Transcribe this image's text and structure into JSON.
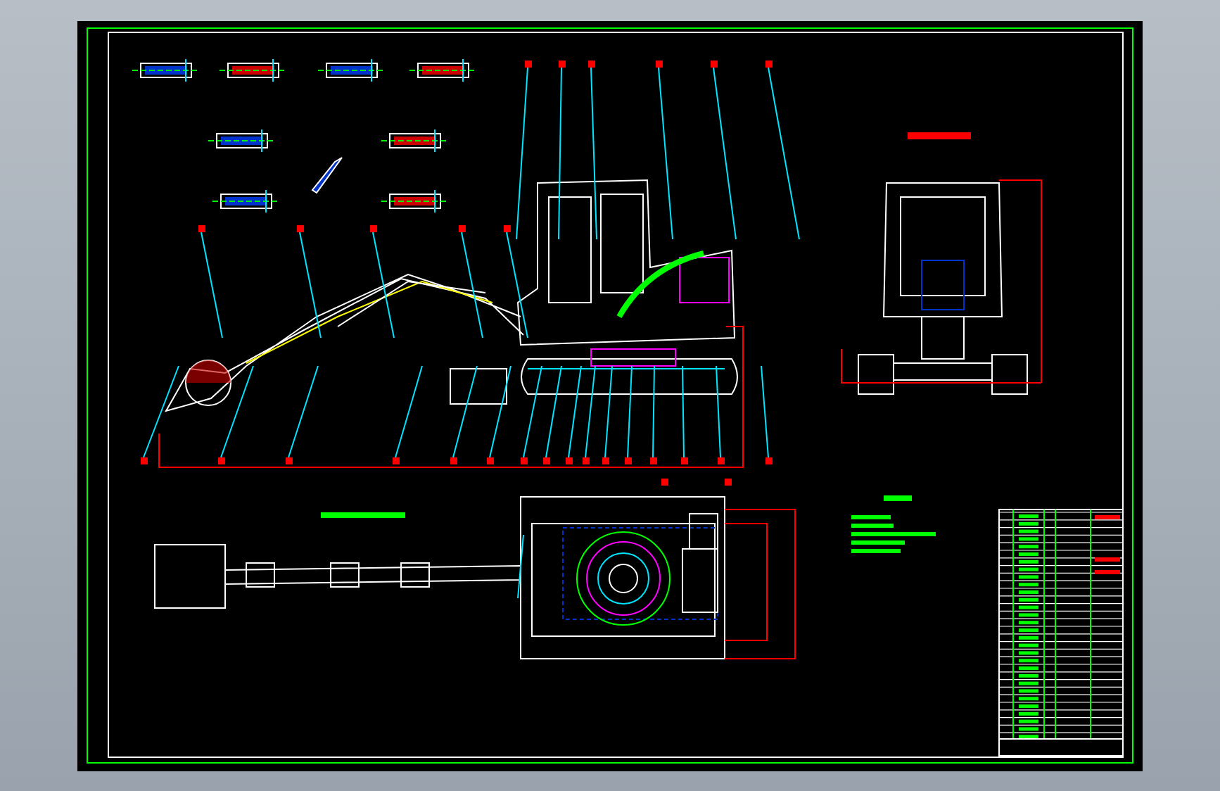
{
  "drawing": {
    "kind": "excavator-assembly"
  }
}
